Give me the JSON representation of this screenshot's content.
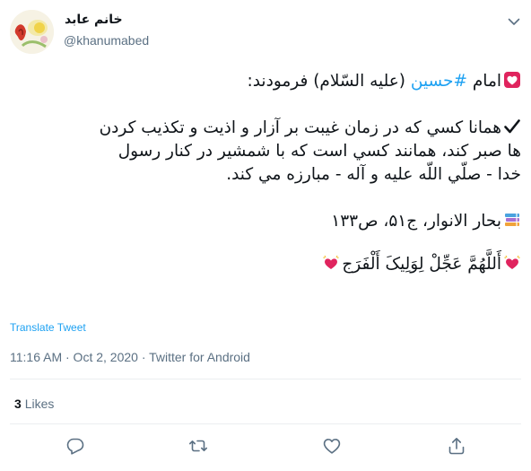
{
  "author": {
    "display_name": "خانم عابد",
    "handle": "@khanumabed"
  },
  "tweet": {
    "line1_prefix": "امام ",
    "line1_hashtag": "#حسین",
    "line1_suffix": " (علیه السّلام) فرمودند:",
    "line2": "همانا كسي كه در زمان غيبت بر آزار و اذيت و تكذيب كردن",
    "line3": "ها صبر كند، همانند كسي است كه با شمشير در كنار رسول",
    "line4": "خدا - صلّي اللّه عليه و آله - مبارزه مي كند.",
    "source": "بحار الانوار، ج۵۱، ص۱۳۳",
    "prayer": "أَللَّهُمَّ عَجِّلْ لِوَلِیکَ أَلْفَرَج"
  },
  "translate_label": "Translate Tweet",
  "meta_text": "11:16 AM · Oct 2, 2020 · Twitter for Android",
  "likes": {
    "count": "3",
    "label": "Likes"
  },
  "icons": {
    "caret": "chevron-down-icon",
    "reply": "reply-icon",
    "retweet": "retweet-icon",
    "like": "heart-icon",
    "share": "share-icon"
  },
  "colors": {
    "accent": "#1da1f2",
    "muted": "#5b7083",
    "text": "#0f1419",
    "heart": "#e0245e"
  }
}
